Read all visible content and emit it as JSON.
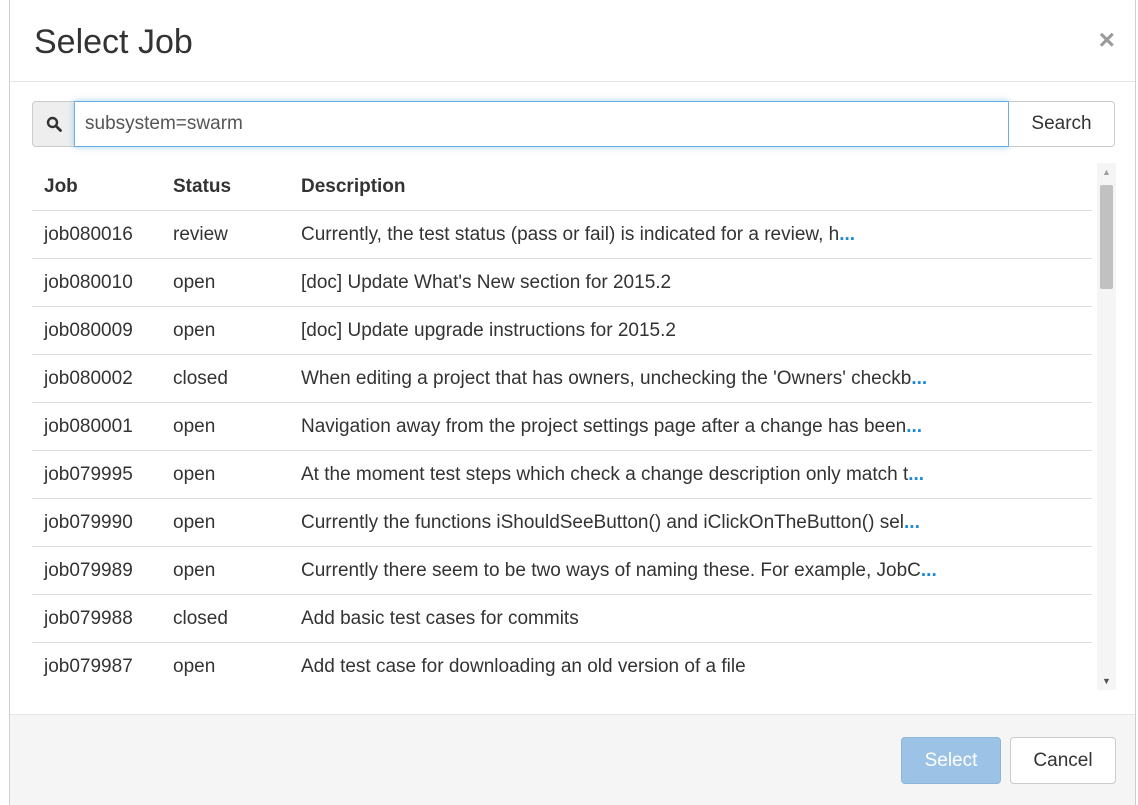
{
  "dialog": {
    "title": "Select Job",
    "close_label": "×"
  },
  "search": {
    "icon": "search-icon",
    "value": "subsystem=swarm",
    "button_label": "Search"
  },
  "table": {
    "headers": [
      "Job",
      "Status",
      "Description"
    ],
    "rows": [
      {
        "job": "job080016",
        "status": "review",
        "description": "Currently, the test status (pass or fail) is indicated for a review, h",
        "ellipsis": "..."
      },
      {
        "job": "job080010",
        "status": "open",
        "description": "[doc] Update What's New section for 2015.2",
        "ellipsis": ""
      },
      {
        "job": "job080009",
        "status": "open",
        "description": "[doc] Update upgrade instructions for 2015.2",
        "ellipsis": ""
      },
      {
        "job": "job080002",
        "status": "closed",
        "description": "When editing a project that has owners, unchecking the 'Owners' checkb",
        "ellipsis": "..."
      },
      {
        "job": "job080001",
        "status": "open",
        "description": "Navigation away from the project settings page after a change has been",
        "ellipsis": "..."
      },
      {
        "job": "job079995",
        "status": "open",
        "description": "At the moment test steps which check a change description only match t",
        "ellipsis": "..."
      },
      {
        "job": "job079990",
        "status": "open",
        "description": "Currently the functions iShouldSeeButton() and iClickOnTheButton() sel",
        "ellipsis": "..."
      },
      {
        "job": "job079989",
        "status": "open",
        "description": "Currently there seem to be two ways of naming these. For example, JobC",
        "ellipsis": "..."
      },
      {
        "job": "job079988",
        "status": "closed",
        "description": "Add basic test cases for commits",
        "ellipsis": ""
      },
      {
        "job": "job079987",
        "status": "open",
        "description": "Add test case for downloading an old version of a file",
        "ellipsis": ""
      }
    ]
  },
  "footer": {
    "select_label": "Select",
    "cancel_label": "Cancel"
  },
  "colors": {
    "accent": "#66afe9",
    "ellipsis": "#1e8ad6",
    "disabled_primary": "#9cc3e5"
  }
}
